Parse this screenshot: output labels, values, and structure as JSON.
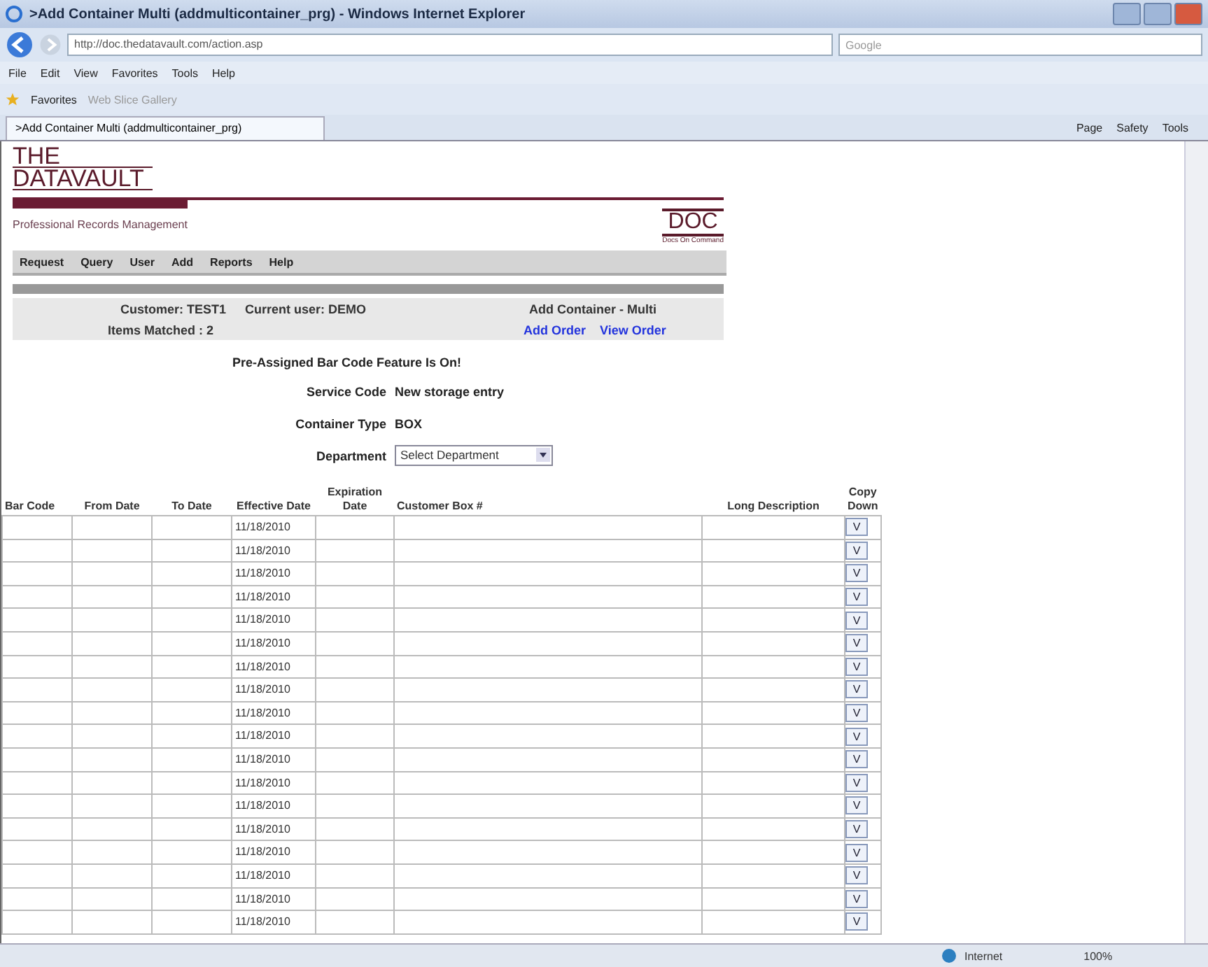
{
  "window": {
    "title": ">Add Container Multi (addmulticontainer_prg) - Windows Internet Explorer"
  },
  "address_bar": {
    "url": "http://doc.thedatavault.com/action.asp",
    "search_placeholder": "Google"
  },
  "menu_bar": [
    "File",
    "Edit",
    "View",
    "Favorites",
    "Tools",
    "Help"
  ],
  "favorites_bar": {
    "label": "Favorites",
    "items": [
      "Web Slice Gallery"
    ]
  },
  "tab": {
    "label": ">Add Container Multi (addmulticontainer_prg)"
  },
  "command_bar": [
    "Page",
    "Safety",
    "Tools"
  ],
  "site": {
    "logo_top": "THE",
    "logo_bottom": "DATAVAULT",
    "tagline": "Professional Records Management",
    "badge": "DOC",
    "badge_caption": "Docs On Command"
  },
  "nav": [
    "Request",
    "Query",
    "User",
    "Add",
    "Reports",
    "Help"
  ],
  "info": {
    "customer": "Customer: TEST1",
    "user": "Current user: DEMO",
    "page": "Add Container - Multi",
    "matched": "Items Matched : 2",
    "links": [
      "Add Order",
      "View Order"
    ]
  },
  "notice": "Pre-Assigned Bar Code Feature Is On!",
  "fields": [
    {
      "kind": "text",
      "label": "Service Code",
      "value": "New storage entry"
    },
    {
      "kind": "text",
      "label": "Container Type",
      "value": "BOX"
    },
    {
      "kind": "select",
      "label": "Department",
      "value": "Select Department"
    }
  ],
  "table": {
    "columns": [
      "Bar Code",
      "From Date",
      "To Date",
      "Effective Date",
      "Expiration Date",
      "Customer Box #",
      "Long Description",
      "Copy Down"
    ],
    "rows": [
      {
        "effective_date": "11/18/2010",
        "copy_down": "V"
      },
      {
        "effective_date": "11/18/2010",
        "copy_down": "V"
      },
      {
        "effective_date": "11/18/2010",
        "copy_down": "V"
      },
      {
        "effective_date": "11/18/2010",
        "copy_down": "V"
      },
      {
        "effective_date": "11/18/2010",
        "copy_down": "V"
      },
      {
        "effective_date": "11/18/2010",
        "copy_down": "V"
      },
      {
        "effective_date": "11/18/2010",
        "copy_down": "V"
      },
      {
        "effective_date": "11/18/2010",
        "copy_down": "V"
      },
      {
        "effective_date": "11/18/2010",
        "copy_down": "V"
      },
      {
        "effective_date": "11/18/2010",
        "copy_down": "V"
      },
      {
        "effective_date": "11/18/2010",
        "copy_down": "V"
      },
      {
        "effective_date": "11/18/2010",
        "copy_down": "V"
      },
      {
        "effective_date": "11/18/2010",
        "copy_down": "V"
      },
      {
        "effective_date": "11/18/2010",
        "copy_down": "V"
      },
      {
        "effective_date": "11/18/2010",
        "copy_down": "V"
      },
      {
        "effective_date": "11/18/2010",
        "copy_down": "V"
      },
      {
        "effective_date": "11/18/2010",
        "copy_down": "V"
      },
      {
        "effective_date": "11/18/2010",
        "copy_down": "V"
      }
    ]
  },
  "status_bar": {
    "zone": "Internet",
    "zoom": "100%"
  }
}
